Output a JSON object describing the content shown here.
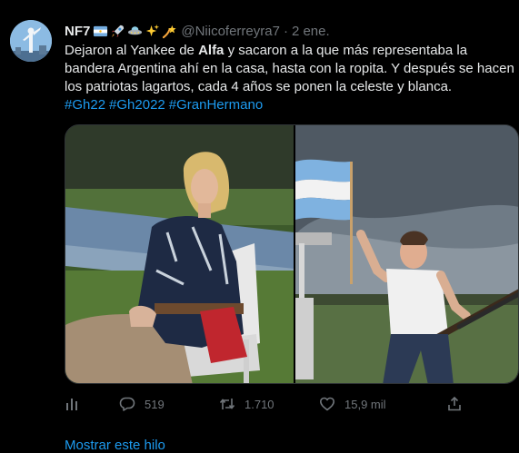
{
  "tweet": {
    "author_name": "NF7",
    "author_handle": "@Niicoferreyra7",
    "separator": "·",
    "date": "2 ene.",
    "emoji_icons": [
      "argentina-flag-icon",
      "rocket-icon",
      "ufo-icon",
      "sparkles-icon",
      "shooting-star-icon"
    ],
    "text_before_bold": "Dejaron al Yankee de ",
    "text_bold": "Alfa",
    "text_after_bold": " y sacaron a la que más representaba la bandera Argentina ahí en la casa, hasta con la ropita. Y después se hacen los patriotas lagartos, cada 4 años se ponen la celeste y blanca.",
    "hashtags": [
      "#Gh22",
      "#Gh2022",
      "#GranHermano"
    ]
  },
  "actions": {
    "replies": "519",
    "retweets": "1.710",
    "likes": "15,9 mil"
  },
  "show_thread": "Mostrar este hilo",
  "colors": {
    "background": "#000000",
    "text": "#e7e9ea",
    "muted": "#71767b",
    "link": "#1d9bf0"
  }
}
